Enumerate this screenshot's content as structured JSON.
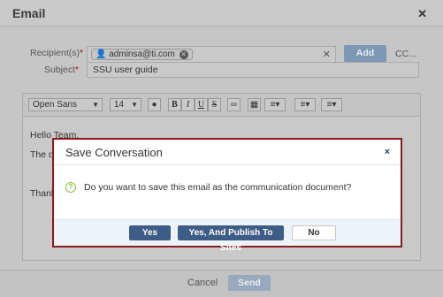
{
  "email": {
    "title": "Email",
    "close_icon": "close-icon",
    "recipients_label": "Recipient(s)",
    "required_mark": "*",
    "recipient_chip": "adminsa@ti.com",
    "add_label": "Add",
    "cc_label": "CC...",
    "subject_label": "Subject",
    "subject_value": "SSU user guide",
    "toolbar": {
      "font_family": "Open Sans",
      "font_size": "14",
      "bold": "B",
      "italic": "I",
      "underline": "U",
      "strike": "S"
    },
    "body_lines": [
      "Hello Team,",
      "The d",
      "",
      "Thank"
    ],
    "cancel_label": "Cancel",
    "send_label": "Send"
  },
  "dialog": {
    "title": "Save Conversation",
    "close_glyph": "×",
    "question_glyph": "?",
    "message": "Do you want to save this email as the communication document?",
    "yes_label": "Yes",
    "yes_publish_label": "Yes, And Publish To Sites",
    "no_label": "No"
  },
  "colors": {
    "dialog_border": "#8b1a1a",
    "primary_button": "#3d5d86",
    "question_icon": "#8dbf3a"
  }
}
